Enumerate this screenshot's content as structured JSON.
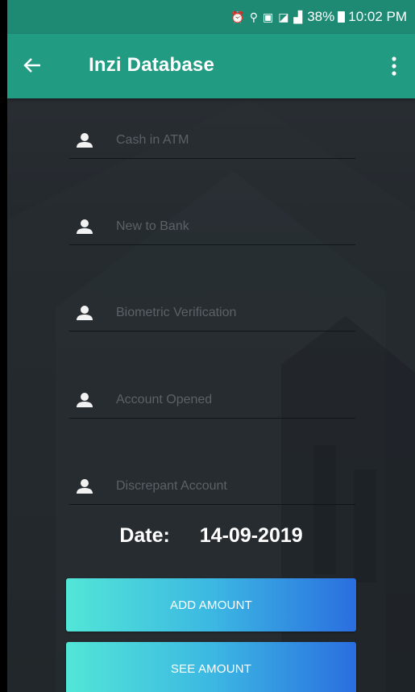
{
  "status_bar": {
    "battery": "38%",
    "time": "10:02 PM"
  },
  "toolbar": {
    "title": "Inzi Database",
    "back_icon": "arrow-left-icon",
    "menu_icon": "more-vertical-icon"
  },
  "fields": [
    {
      "placeholder": "Cash in ATM",
      "icon": "person-icon"
    },
    {
      "placeholder": "New to Bank",
      "icon": "person-icon"
    },
    {
      "placeholder": "Biometric Verification",
      "icon": "person-icon"
    },
    {
      "placeholder": "Account Opened",
      "icon": "person-icon"
    },
    {
      "placeholder": "Discrepant Account",
      "icon": "person-icon"
    }
  ],
  "date": {
    "label": "Date:",
    "value": "14-09-2019"
  },
  "buttons": {
    "add_amount": "ADD AMOUNT",
    "see_amount": "SEE AMOUNT"
  },
  "colors": {
    "toolbar": "#219b82",
    "status_bar": "#1f8a74",
    "background": "#23282d",
    "button_gradient_start": "#52e6d7",
    "button_gradient_end": "#2a6ee0"
  }
}
